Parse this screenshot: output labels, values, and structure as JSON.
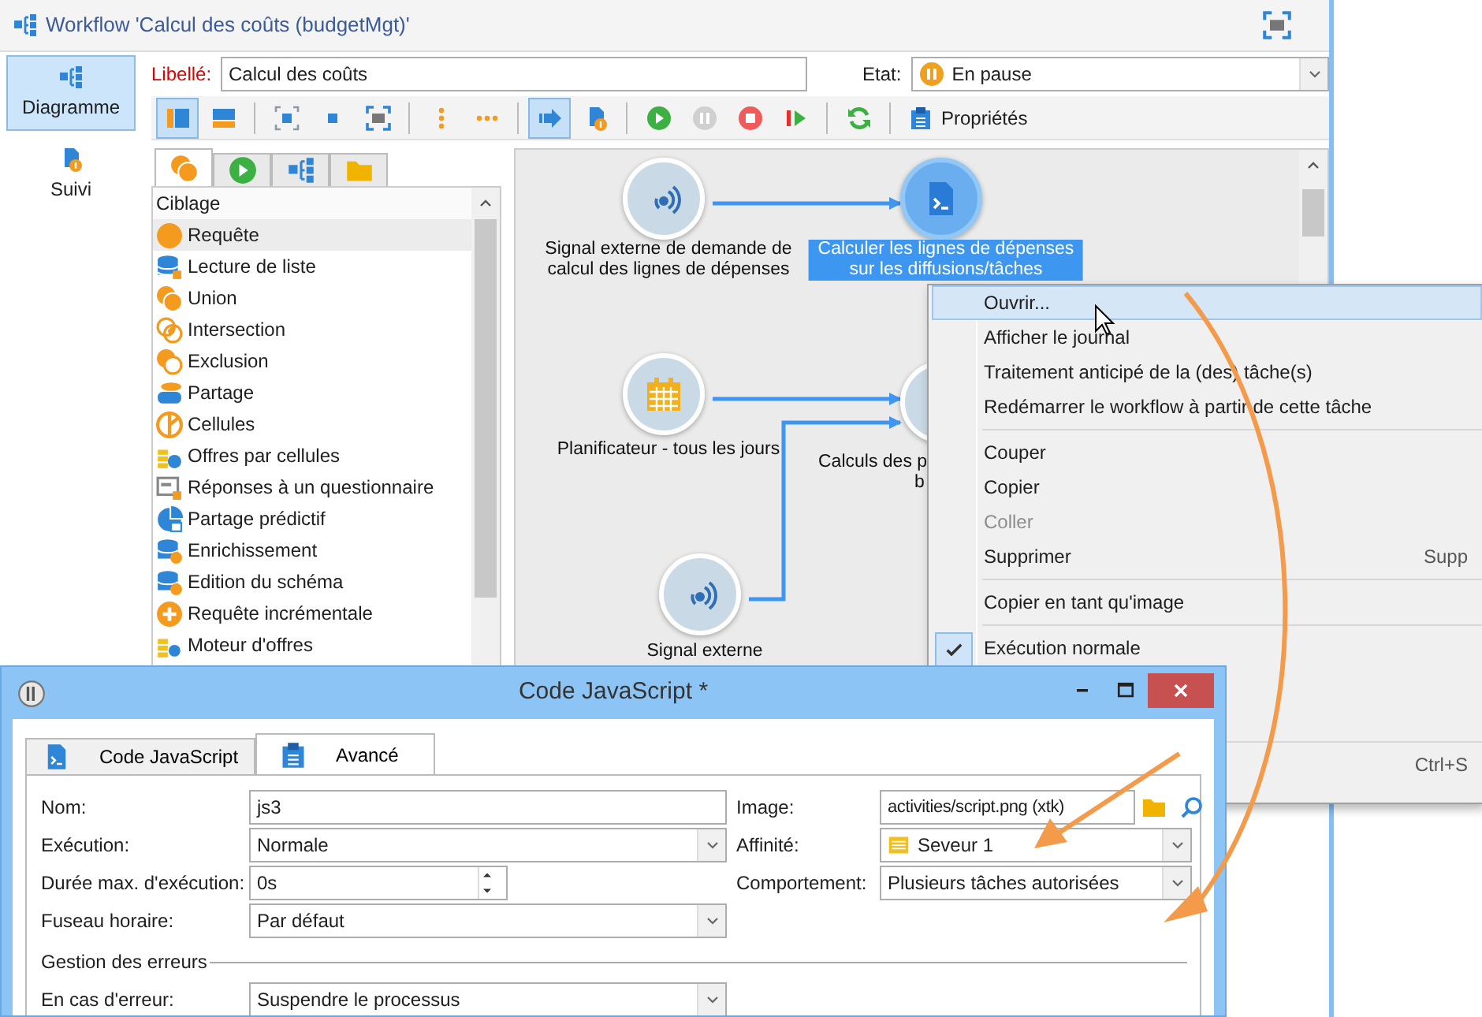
{
  "workflow": {
    "title": "Workflow 'Calcul des coûts (budgetMgt)'"
  },
  "nav": [
    {
      "label": "Diagramme",
      "selected": true
    },
    {
      "label": "Suivi",
      "selected": false
    }
  ],
  "label_field": {
    "label": "Libellé:",
    "value": "Calcul des coûts"
  },
  "state_field": {
    "label": "Etat:",
    "value": "En pause"
  },
  "toolbar": [
    {
      "kind": "button",
      "selected": true,
      "disabled": false
    },
    {
      "kind": "button",
      "selected": false,
      "disabled": false
    },
    {
      "kind": "separator"
    },
    {
      "kind": "button",
      "selected": false,
      "disabled": false
    },
    {
      "kind": "button",
      "selected": false,
      "disabled": false
    },
    {
      "kind": "button",
      "selected": false,
      "disabled": false
    },
    {
      "kind": "separator"
    },
    {
      "kind": "button",
      "selected": false,
      "disabled": false
    },
    {
      "kind": "button",
      "selected": false,
      "disabled": false
    },
    {
      "kind": "separator"
    },
    {
      "kind": "button",
      "selected": true,
      "disabled": false
    },
    {
      "kind": "button",
      "selected": false,
      "disabled": false
    },
    {
      "kind": "separator"
    },
    {
      "kind": "button",
      "selected": false,
      "disabled": false
    },
    {
      "kind": "button",
      "selected": false,
      "disabled": true
    },
    {
      "kind": "button",
      "selected": false,
      "disabled": false
    },
    {
      "kind": "button",
      "selected": false,
      "disabled": false
    },
    {
      "kind": "separator"
    },
    {
      "kind": "button",
      "selected": false,
      "disabled": false
    },
    {
      "kind": "separator"
    },
    {
      "kind": "text_button",
      "label": "Propriétés",
      "selected": false,
      "disabled": false
    }
  ],
  "palette_tabs": [
    {
      "selected": true
    },
    {
      "selected": false
    },
    {
      "selected": false
    },
    {
      "selected": false
    }
  ],
  "palette": {
    "group": "Ciblage",
    "items": [
      {
        "label": "Requête",
        "selected": true
      },
      {
        "label": "Lecture de liste",
        "selected": false
      },
      {
        "label": "Union",
        "selected": false
      },
      {
        "label": "Intersection",
        "selected": false
      },
      {
        "label": "Exclusion",
        "selected": false
      },
      {
        "label": "Partage",
        "selected": false
      },
      {
        "label": "Cellules",
        "selected": false
      },
      {
        "label": "Offres par cellules",
        "selected": false
      },
      {
        "label": "Réponses à un questionnaire",
        "selected": false
      },
      {
        "label": "Partage prédictif",
        "selected": false
      },
      {
        "label": "Enrichissement",
        "selected": false
      },
      {
        "label": "Edition du schéma",
        "selected": false
      },
      {
        "label": "Requête incrémentale",
        "selected": false
      },
      {
        "label": "Moteur d'offres",
        "selected": false
      }
    ]
  },
  "diagram": {
    "nodes": [
      {
        "label_lines": [
          "Signal externe de demande de",
          "calcul des lignes de dépenses"
        ],
        "selected": false
      },
      {
        "label_lines": [
          "Calculer les lignes de dépenses",
          "sur les diffusions/tâches"
        ],
        "selected": true
      },
      {
        "label_lines": [
          "Planificateur - tous les jours"
        ],
        "selected": false
      },
      {
        "label_lines": [
          "Calculs des p",
          "b"
        ],
        "selected": false
      },
      {
        "label_lines": [
          "Signal externe"
        ],
        "selected": false
      }
    ]
  },
  "context_menu": [
    {
      "kind": "item",
      "label": "Ouvrir...",
      "selected": true,
      "disabled": false,
      "checked": false
    },
    {
      "kind": "item",
      "label": "Afficher le journal",
      "selected": false,
      "disabled": false,
      "checked": false
    },
    {
      "kind": "item",
      "label": "Traitement anticipé de la (des) tâche(s)",
      "selected": false,
      "disabled": false,
      "checked": false
    },
    {
      "kind": "item",
      "label": "Redémarrer le workflow à partir de cette tâche",
      "selected": false,
      "disabled": false,
      "checked": false
    },
    {
      "kind": "separator"
    },
    {
      "kind": "item",
      "label": "Couper",
      "selected": false,
      "disabled": false,
      "checked": false
    },
    {
      "kind": "item",
      "label": "Copier",
      "selected": false,
      "disabled": false,
      "checked": false
    },
    {
      "kind": "item",
      "label": "Coller",
      "selected": false,
      "disabled": true,
      "checked": false
    },
    {
      "kind": "item",
      "label": "Supprimer",
      "shortcut": "Supp",
      "selected": false,
      "disabled": false,
      "checked": false
    },
    {
      "kind": "separator"
    },
    {
      "kind": "item",
      "label": "Copier en tant qu'image",
      "selected": false,
      "disabled": false,
      "checked": false
    },
    {
      "kind": "separator"
    },
    {
      "kind": "item",
      "label": "Exécution normale",
      "selected": false,
      "disabled": false,
      "checked": true
    },
    {
      "kind": "separator"
    },
    {
      "kind": "item",
      "shortcut": "Ctrl+S",
      "selected": false,
      "disabled": false
    }
  ],
  "dialog": {
    "title": "Code JavaScript *",
    "tabs": [
      {
        "label": "Code JavaScript",
        "selected": false
      },
      {
        "label": "Avancé",
        "selected": true
      }
    ],
    "fields_left": [
      {
        "kind": "text",
        "label": "Nom:",
        "value": "js3"
      },
      {
        "kind": "select",
        "label": "Exécution:",
        "value": "Normale"
      },
      {
        "kind": "spinner",
        "label": "Durée max. d'exécution:",
        "value": "0s"
      },
      {
        "kind": "select",
        "label": "Fuseau horaire:",
        "value": "Par défaut"
      }
    ],
    "fields_right": [
      {
        "kind": "picker",
        "label": "Image:",
        "value": "activities/script.png (xtk)"
      },
      {
        "kind": "select",
        "label": "Affinité:",
        "value": "Seveur 1"
      },
      {
        "kind": "select",
        "label": "Comportement:",
        "value": "Plusieurs tâches autorisées"
      }
    ],
    "error_group": {
      "title": "Gestion des erreurs",
      "fields": [
        {
          "kind": "select",
          "label": "En cas d'erreur:",
          "value": "Suspendre le processus"
        }
      ]
    }
  }
}
